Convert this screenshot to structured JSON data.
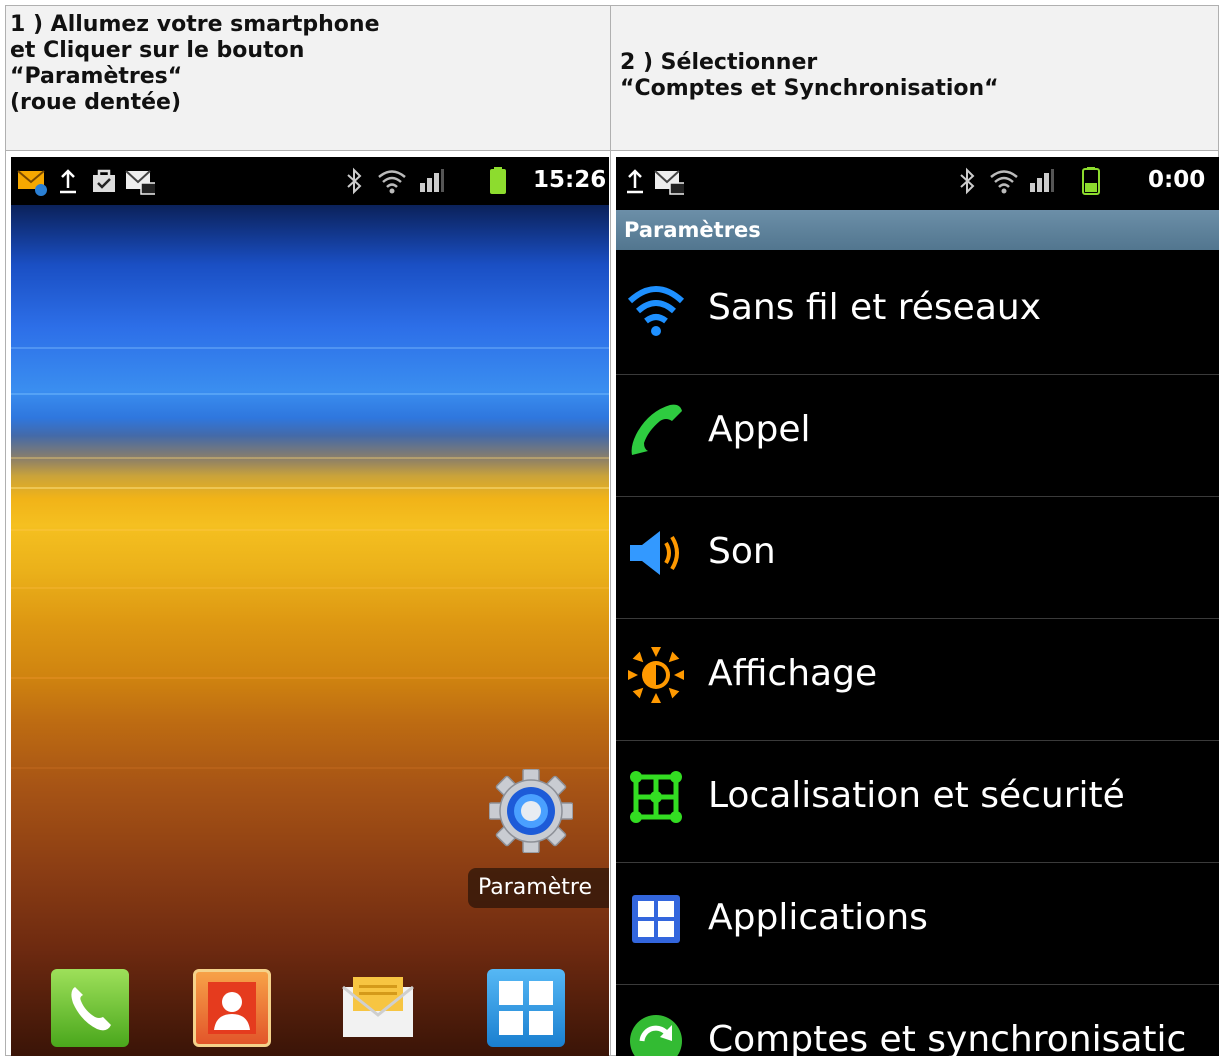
{
  "header": {
    "step1": "1 ) Allumez votre smartphone\net Cliquer sur le bouton\n“Paramètres“\n(roue dentée)",
    "step2": "2 ) Sélectionner\n“Comptes et Synchronisation“"
  },
  "left_phone": {
    "status_time": "15:26",
    "status_icons": [
      "email-icon",
      "upload-icon",
      "bag-icon",
      "voicemail-icon",
      "bluetooth-icon",
      "wifi-icon",
      "signal-icon",
      "battery-icon"
    ],
    "shortcut_label": "Paramètre",
    "shortcut_icon": "gear-icon",
    "dock": [
      "phone-icon",
      "contacts-icon",
      "messaging-icon",
      "apps-icon"
    ]
  },
  "right_phone": {
    "status_time": "0:00",
    "title": "Paramètres",
    "settings_items": [
      {
        "label": "Sans fil et réseaux",
        "icon": "wifi-icon"
      },
      {
        "label": "Appel",
        "icon": "phone-icon"
      },
      {
        "label": "Son",
        "icon": "speaker-icon"
      },
      {
        "label": "Affichage",
        "icon": "brightness-icon"
      },
      {
        "label": "Localisation et sécurité",
        "icon": "location-security-icon"
      },
      {
        "label": "Applications",
        "icon": "applications-icon"
      },
      {
        "label": "Comptes et synchronisatic",
        "icon": "sync-icon"
      }
    ]
  },
  "colors": {
    "titlebar": "#5e829b",
    "wifi": "#1e90ff",
    "call": "#2ecc40",
    "sound": "#3399ff",
    "display": "#ff9900",
    "location": "#33dd22",
    "apps": "#3366dd",
    "sync": "#33bb33"
  }
}
